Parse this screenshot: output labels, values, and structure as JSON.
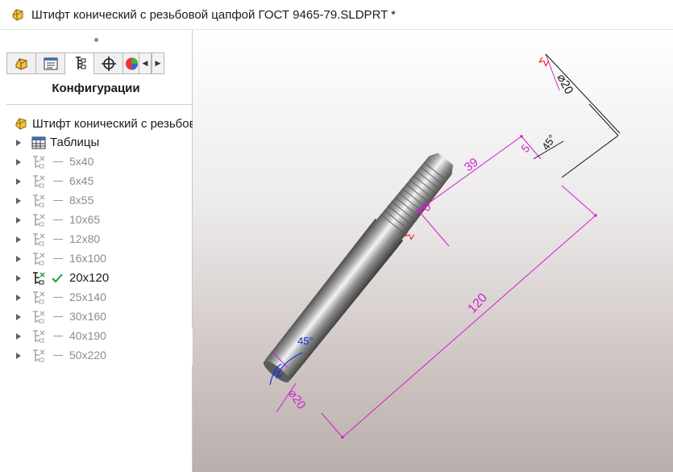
{
  "window": {
    "title": "Штифт конический с резьбовой цапфой ГОСТ 9465-79.SLDPRT *"
  },
  "panel": {
    "tabs": [
      "feature-manager",
      "property-manager",
      "configuration-manager",
      "dimxpert-manager",
      "display-manager"
    ],
    "active_tab": "configuration-manager",
    "heading": "Конфигурации"
  },
  "tree": {
    "root_label": "Штифт конический с резьбов",
    "tables_label": "Таблицы",
    "configs": [
      {
        "label": "5x40",
        "active": false
      },
      {
        "label": "6x45",
        "active": false
      },
      {
        "label": "8x55",
        "active": false
      },
      {
        "label": "10x65",
        "active": false
      },
      {
        "label": "12x80",
        "active": false
      },
      {
        "label": "16x100",
        "active": false
      },
      {
        "label": "20x120",
        "active": true
      },
      {
        "label": "25x140",
        "active": false
      },
      {
        "label": "30x160",
        "active": false
      },
      {
        "label": "40x190",
        "active": false
      },
      {
        "label": "50x220",
        "active": false
      }
    ]
  },
  "dimensions": {
    "d_top": "⌀20",
    "sigma": "Σ",
    "d_end": "5",
    "chamfer_top": "45°",
    "thread_len": "39",
    "shoulder": "6",
    "length": "120",
    "d_bottom": "⌀20",
    "chamfer_bottom": "45°",
    "chamfer_bottom_small": "2"
  },
  "colors": {
    "dimension_magenta": "#d020d0",
    "dimension_black": "#111111",
    "dimension_blue": "#1a2fe0",
    "sigma_red": "#e0201e"
  }
}
